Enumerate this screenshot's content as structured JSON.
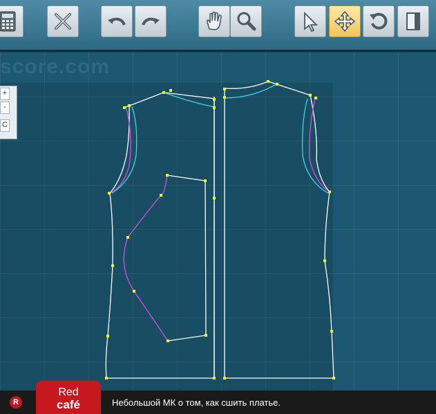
{
  "toolbar": {
    "buttons": [
      {
        "name": "calculator-button",
        "icon": "calculator-icon"
      },
      {
        "name": "delete-button",
        "icon": "x-icon"
      },
      {
        "name": "undo-button",
        "icon": "undo-arrow-icon"
      },
      {
        "name": "redo-button",
        "icon": "redo-arrow-icon"
      },
      {
        "name": "pan-button",
        "icon": "hand-icon"
      },
      {
        "name": "zoom-button",
        "icon": "magnifier-icon"
      },
      {
        "name": "select-button",
        "icon": "cursor-arrow-icon"
      },
      {
        "name": "move-button",
        "icon": "move-arrows-icon",
        "active": true
      },
      {
        "name": "rotate-button",
        "icon": "rotate-icon"
      },
      {
        "name": "page-button",
        "icon": "page-icon"
      }
    ]
  },
  "canvas": {
    "watermark": "score.com",
    "zoom": {
      "plus": "+",
      "minus": "-",
      "reset": "C"
    }
  },
  "colors": {
    "pattern_line": "#ffffff",
    "seam_cyan": "#3fd8e8",
    "curve_magenta": "#d44fe0",
    "control_point": "#f2f21a"
  },
  "bottom": {
    "badge": "R",
    "brand_line1": "Red",
    "brand_line2": "café",
    "message": "Небольшой МК о том, как сшить платье."
  }
}
